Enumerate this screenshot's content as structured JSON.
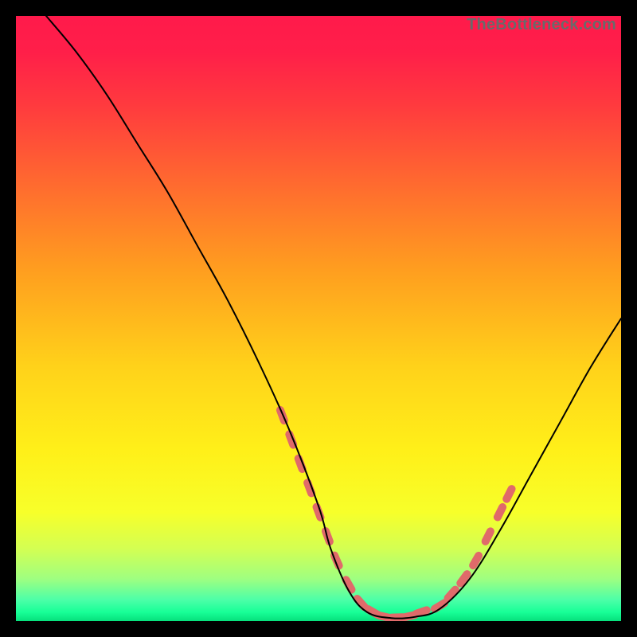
{
  "watermark": {
    "text": "TheBottleneck.com"
  },
  "gradient": {
    "stops": [
      {
        "offset": 0.0,
        "color": "#ff1a4b"
      },
      {
        "offset": 0.06,
        "color": "#ff1f49"
      },
      {
        "offset": 0.15,
        "color": "#ff3b3e"
      },
      {
        "offset": 0.28,
        "color": "#ff6b2f"
      },
      {
        "offset": 0.42,
        "color": "#ff9e1f"
      },
      {
        "offset": 0.58,
        "color": "#ffd21a"
      },
      {
        "offset": 0.72,
        "color": "#fff019"
      },
      {
        "offset": 0.82,
        "color": "#f7ff2a"
      },
      {
        "offset": 0.88,
        "color": "#d4ff52"
      },
      {
        "offset": 0.93,
        "color": "#9fff80"
      },
      {
        "offset": 0.965,
        "color": "#4cffa8"
      },
      {
        "offset": 0.985,
        "color": "#18ff97"
      },
      {
        "offset": 1.0,
        "color": "#06e07c"
      }
    ]
  },
  "chart_data": {
    "type": "line",
    "title": "",
    "xlabel": "",
    "ylabel": "",
    "xlim": [
      0,
      100
    ],
    "ylim": [
      0,
      100
    ],
    "grid": false,
    "legend": false,
    "note": "Values estimated from pixel positions; y normalized 0-100 (0 = bottom of plot, 100 = top).",
    "series": [
      {
        "name": "curve",
        "x": [
          5,
          10,
          15,
          20,
          25,
          30,
          35,
          40,
          45,
          50,
          52,
          55,
          58,
          62,
          66,
          70,
          75,
          80,
          85,
          90,
          95,
          100
        ],
        "y": [
          100,
          94,
          87,
          79,
          71,
          62,
          53,
          43,
          32,
          19,
          12,
          5,
          1.5,
          0.5,
          0.7,
          2,
          7,
          15,
          24,
          33,
          42,
          50
        ],
        "color": "#000000",
        "linewidth": 2
      }
    ],
    "overlays": [
      {
        "name": "dotted-segments",
        "type": "scatter",
        "color": "#e06a6a",
        "marker_size": 10,
        "x": [
          44,
          45.5,
          47,
          48.5,
          50,
          51.5,
          53,
          55,
          57,
          59,
          61,
          63,
          65,
          67,
          70,
          72,
          74,
          76,
          78,
          80,
          81.5
        ],
        "y": [
          34,
          30,
          26,
          22,
          18,
          14,
          10,
          6,
          3,
          1.5,
          0.7,
          0.6,
          0.8,
          1.5,
          2.5,
          4.5,
          7,
          10,
          14,
          18,
          21
        ]
      }
    ]
  }
}
